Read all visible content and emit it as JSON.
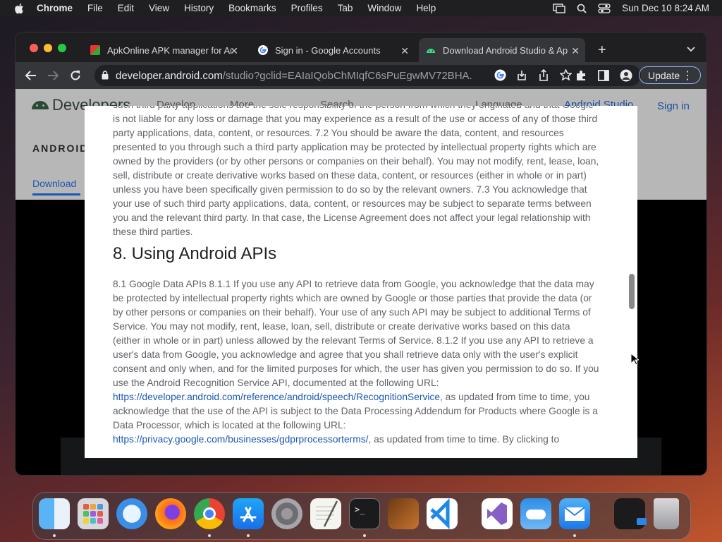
{
  "menubar": {
    "app": "Chrome",
    "items": [
      "File",
      "Edit",
      "View",
      "History",
      "Bookmarks",
      "Profiles",
      "Tab",
      "Window",
      "Help"
    ],
    "datetime": "Sun Dec 10  8:24 AM"
  },
  "tabs": [
    {
      "title": "ApkOnline APK manager for An"
    },
    {
      "title": "Sign in - Google Accounts"
    },
    {
      "title": "Download Android Studio & Ap"
    }
  ],
  "toolbar": {
    "url_host": "developer.android.com",
    "url_rest": "/studio?gclid=EAIaIQobChMIqfC6sPuEgwMV72BHA...",
    "update_label": "Update"
  },
  "site": {
    "logo": "Developers",
    "nav": [
      "Develop",
      "More",
      "Search",
      "Language",
      "Android Studio"
    ],
    "signin": "Sign in",
    "section": "ANDROID",
    "download_tab": "Download"
  },
  "dialog": {
    "para1": "such third party applications are the sole responsibility of the person from which they originated and that Google is not liable for any loss or damage that you may experience as a result of the use or access of any of those third party applications, data, content, or resources. 7.2 You should be aware the data, content, and resources presented to you through such a third party application may be protected by intellectual property rights which are owned by the providers (or by other persons or companies on their behalf). You may not modify, rent, lease, loan, sell, distribute or create derivative works based on these data, content, or resources (either in whole or in part) unless you have been specifically given permission to do so by the relevant owners. 7.3 You acknowledge that your use of such third party applications, data, content, or resources may be subject to separate terms between you and the relevant third party. In that case, the License Agreement does not affect your legal relationship with these third parties.",
    "heading": "8. Using Android APIs",
    "para2a": "8.1 Google Data APIs 8.1.1 If you use any API to retrieve data from Google, you acknowledge that the data may be protected by intellectual property rights which are owned by Google or those parties that provide the data (or by other persons or companies on their behalf). Your use of any such API may be subject to additional Terms of Service. You may not modify, rent, lease, loan, sell, distribute or create derivative works based on this data (either in whole or in part) unless allowed by the relevant Terms of Service. 8.1.2 If you use any API to retrieve a user's data from Google, you acknowledge and agree that you shall retrieve data only with the user's explicit consent and only when, and for the limited purposes for which, the user has given you permission to do so. If you use the Android Recognition Service API, documented at the following URL: ",
    "link1": "https://developer.android.com/reference/android/speech/RecognitionService",
    "para2b": ", as updated from time to time, you acknowledge that the use of the API is subject to the Data Processing Addendum for Products where Google is a Data Processor, which is located at the following URL: ",
    "link2": "https://privacy.google.com/businesses/gdprprocessorterms/",
    "para2c": ", as updated from time to time. By clicking to"
  },
  "dock": {
    "apps": [
      "Finder",
      "Launchpad",
      "Safari",
      "Firefox",
      "Chrome",
      "App Store",
      "System Preferences",
      "TextEdit",
      "Terminal",
      "GarageBand",
      "VS Code",
      "Visual Studio",
      "Weather",
      "Mail",
      "Screen",
      "Trash"
    ]
  }
}
